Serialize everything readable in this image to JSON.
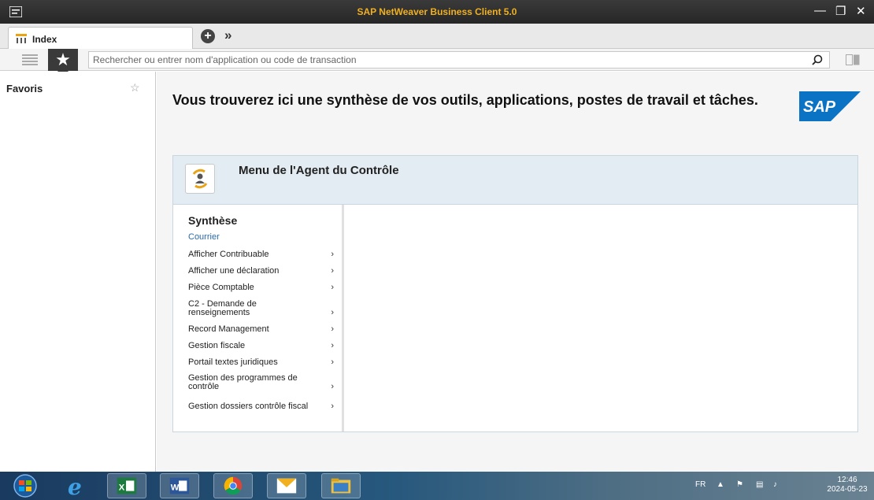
{
  "window": {
    "title": "SAP NetWeaver Business Client 5.0"
  },
  "tabs": [
    {
      "label": "Index"
    }
  ],
  "search": {
    "placeholder": "Rechercher ou entrer nom d'application ou code de transaction"
  },
  "sidebar": {
    "title": "Favoris"
  },
  "main": {
    "headline": "Vous trouverez ici une synthèse de vos outils, applications, postes de travail et tâches.",
    "logo_text": "SAP",
    "card": {
      "title": "Menu de l'Agent du Contrôle",
      "section_heading": "Synthèse",
      "link": "Courrier",
      "items": [
        {
          "label": "Afficher Contribuable"
        },
        {
          "label": "Afficher une déclaration"
        },
        {
          "label": "Pièce Comptable"
        },
        {
          "label": "C2 - Demande de renseignements"
        },
        {
          "label": "Record Management"
        },
        {
          "label": "Gestion fiscale"
        },
        {
          "label": "Portail textes juridiques"
        },
        {
          "label": "Gestion des programmes de contrôle"
        },
        {
          "label": "Gestion dossiers contrôle fiscal"
        }
      ]
    }
  },
  "taskbar": {
    "language": "FR",
    "time": "12:46",
    "date": "2024-05-23"
  },
  "colors": {
    "accent": "#f0b020",
    "card_header": "#e3ecf2",
    "link": "#2a6aa8",
    "sap_blue": "#0a73c4"
  }
}
